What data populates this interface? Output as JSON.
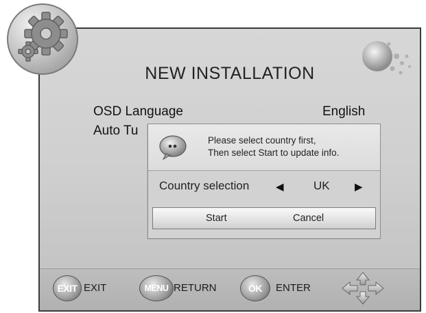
{
  "screen": {
    "title": "NEW INSTALLATION",
    "rows": [
      {
        "label": "OSD Language",
        "value": "English"
      },
      {
        "label": "Auto Tu",
        "value": ""
      }
    ]
  },
  "dialog": {
    "message_line1": "Please select country first,",
    "message_line2": "Then select Start to update info.",
    "country_label": "Country selection",
    "country_value": "UK",
    "left_arrow": "◀",
    "right_arrow": "▶",
    "start_label": "Start",
    "cancel_label": "Cancel"
  },
  "footer": {
    "exit_key": "EXIT",
    "exit_label": "EXIT",
    "menu_key": "MENU",
    "menu_label": "RETURN",
    "ok_key": "OK",
    "ok_label": "ENTER"
  },
  "icons": {
    "badge": "gear-icon",
    "dialog": "speech-bubble-icon",
    "navigation": "arrows-cross-icon",
    "decoration": "globe-icon"
  },
  "colors": {
    "panel": "#cfcfcf",
    "footer": "#b5b5b5",
    "text": "#1a1a1a"
  }
}
